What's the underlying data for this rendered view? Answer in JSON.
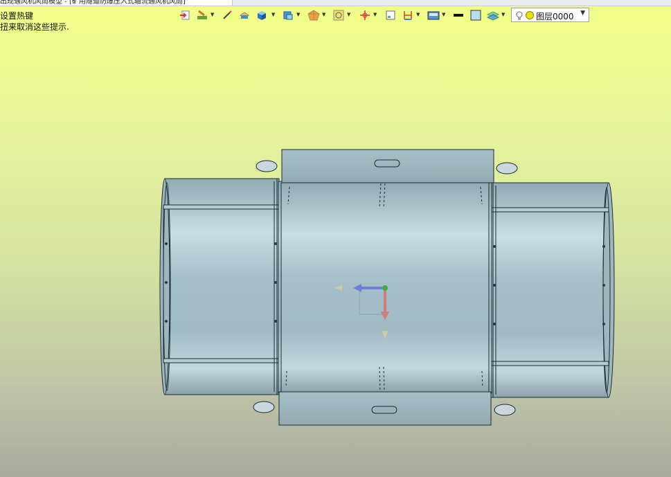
{
  "document_tab": {
    "title": "出现通风机风筒模型 - [矿用隧道防爆压入式轴流通风机风筒]"
  },
  "hints": {
    "line1": "设置热键",
    "line2": "扭来取消这些提示."
  },
  "toolbar": {
    "buttons": [
      {
        "name": "import-icon"
      },
      {
        "name": "paint-brush-icon"
      },
      {
        "name": "pencil-icon"
      },
      {
        "name": "eraser-box-icon"
      },
      {
        "name": "solid-box-icon"
      },
      {
        "name": "view-cube-icon"
      },
      {
        "name": "render-style-icon"
      },
      {
        "name": "snap-target-icon"
      },
      {
        "name": "axis-cross-icon"
      },
      {
        "name": "small-frame-icon"
      },
      {
        "name": "dimension-icon"
      },
      {
        "name": "layer-manager-icon"
      },
      {
        "name": "line-weight-icon"
      },
      {
        "name": "fill-color-icon"
      },
      {
        "name": "layer-stack-icon"
      }
    ],
    "layer": {
      "name": "图层0000",
      "bulb_icon": "lightbulb-icon",
      "dot_color": "#e8e200"
    }
  },
  "colors": {
    "bg_top": "#f2ff86",
    "bg_bottom": "#a9aa9c",
    "model_body": "#a9c4cc",
    "model_edge": "#1a2a33",
    "axis_x": "#6f7fd8",
    "axis_y": "#d47a7a",
    "origin": "#3faa3f"
  }
}
